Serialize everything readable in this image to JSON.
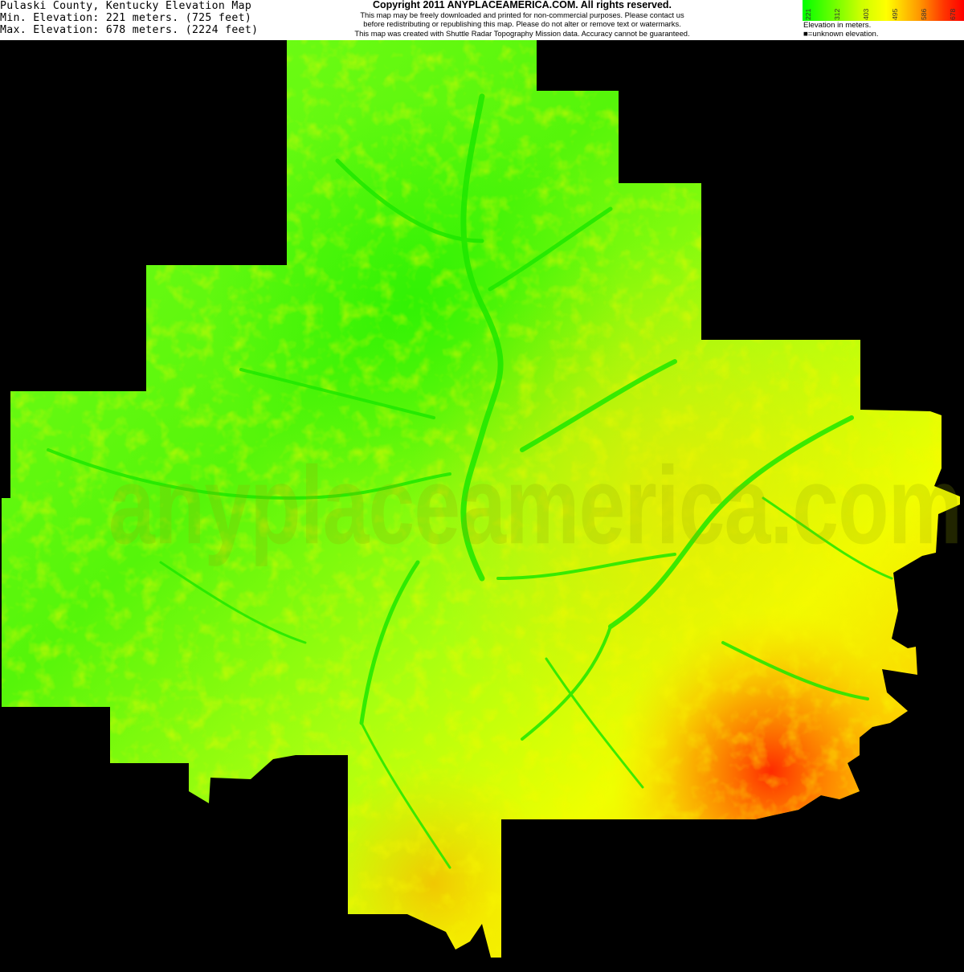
{
  "header": {
    "title": "Pulaski County, Kentucky Elevation Map",
    "min_elevation": "Min. Elevation: 221 meters. (725 feet)",
    "max_elevation": "Max. Elevation: 678 meters. (2224 feet)",
    "copyright_title": "Copyright 2011 ANYPLACEAMERICA.COM.  All rights reserved.",
    "copyright_lines": [
      "This map may be freely downloaded and printed for non-commercial purposes.  Please contact us",
      "before redistributing or republishing this map.  Please do not alter or remove text or watermarks.",
      "This map was created with Shuttle Radar Topography Mission data.  Accuracy cannot be guaranteed."
    ]
  },
  "legend": {
    "ticks": [
      "221",
      "312",
      "403",
      "495",
      "586",
      "678"
    ],
    "caption": "Elevation in meters.",
    "unknown_note": "■=unknown elevation.",
    "colors": [
      "#00ff00",
      "#ccff00",
      "#ffff00",
      "#ff9900",
      "#ff0000"
    ]
  },
  "map": {
    "watermark": "anyplaceamerica.com",
    "background_color": "#000000",
    "low_color": "#00ff00",
    "high_color": "#ff0000"
  }
}
